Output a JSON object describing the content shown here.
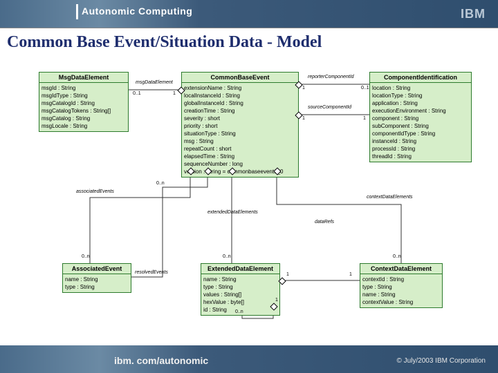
{
  "header": {
    "title": "Autonomic Computing",
    "logo": "IBM"
  },
  "title": "Common Base Event/Situation Data - Model",
  "footer": {
    "link": "ibm. com/autonomic",
    "copyright": "© July/2003 IBM Corporation"
  },
  "boxes": {
    "msg": {
      "name": "MsgDataElement",
      "attrs": [
        "msgId : String",
        "msgIdType : String",
        "msgCatalogId : String",
        "msgCatalogTokens : String[]",
        "msgCatalog : String",
        "msgLocale : String"
      ]
    },
    "cbe": {
      "name": "CommonBaseEvent",
      "attrs": [
        "extensionName : String",
        "localInstanceId : String",
        "globalInstanceId : String",
        "creationTime : String",
        "severity : short",
        "priority : short",
        "situationType : String",
        "msg : String",
        "repeatCount : short",
        "elapsedTime : String",
        "sequenceNumber : long",
        "version : String = commonbaseevent1_0"
      ]
    },
    "comp": {
      "name": "ComponentIdentification",
      "attrs": [
        "location : String",
        "locationType : String",
        "application : String",
        "executionEnvironment : String",
        "component : String",
        "subComponent : String",
        "componentIdType : String",
        "instanceId : String",
        "processId : String",
        "threadId : String"
      ]
    },
    "assoc": {
      "name": "AssociatedEvent",
      "attrs": [
        "name : String",
        "type : String"
      ]
    },
    "ext": {
      "name": "ExtendedDataElement",
      "attrs": [
        "name : String",
        "type : String",
        "values : String[]",
        "hexValue : byte[]",
        "id : String"
      ]
    },
    "ctx": {
      "name": "ContextDataElement",
      "attrs": [
        "contextId : String",
        "type : String",
        "name : String",
        "contextValue : String"
      ]
    }
  },
  "labels": {
    "msgDataElement": "msgDataElement",
    "reporterComponentId": "reporterComponentId",
    "sourceComponentId": "sourceComponentId",
    "associatedEvents": "associatedEvents",
    "extendedDataElements": "extendedDataElements",
    "contextDataElements": "contextDataElements",
    "resolvedEvents": "resolvedEvents",
    "dataRefs": "dataRefs",
    "c0_1": "0..1",
    "c0_n": "0..n",
    "c1": "1"
  }
}
